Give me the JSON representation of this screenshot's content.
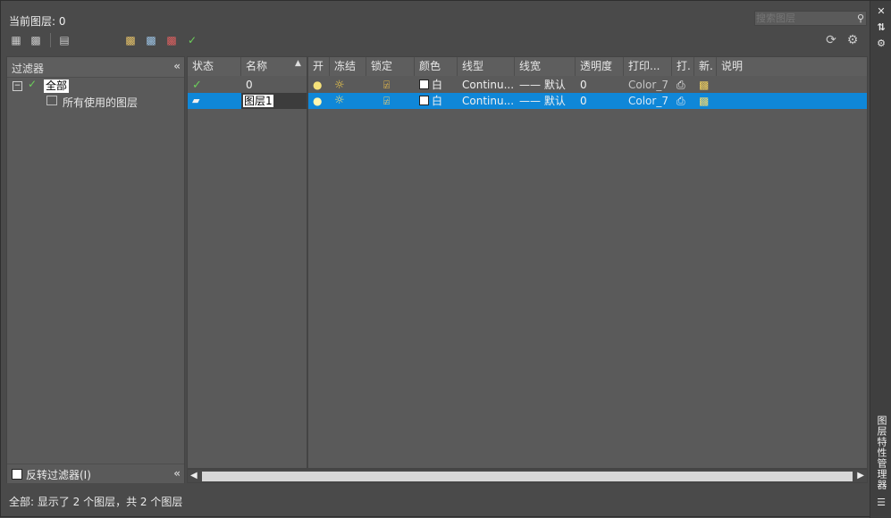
{
  "header": {
    "current_layer": "当前图层: 0",
    "search_placeholder": "搜索图层"
  },
  "toolbar": {
    "icons": [
      "new-property-filter-icon",
      "new-group-filter-icon",
      "layer-states-manager-icon",
      "new-layer-icon",
      "new-layer-vp-frozen-icon",
      "delete-layer-icon",
      "set-current-icon",
      "refresh-icon",
      "settings-icon"
    ]
  },
  "side_strip": {
    "title": "图层特性管理器"
  },
  "filter_panel": {
    "header": "过滤器",
    "tree": {
      "root": "全部",
      "child": "所有使用的图层"
    },
    "invert_filter": "反转过滤器(I)"
  },
  "table": {
    "columns": [
      "状态",
      "名称",
      "开",
      "冻结",
      "锁定",
      "颜色",
      "线型",
      "线宽",
      "透明度",
      "打印...",
      "打.",
      "新.",
      "说明"
    ],
    "rows": [
      {
        "status": "current",
        "name": "0",
        "on": "lightbulb-on",
        "freeze": "sun-thawed",
        "lock": "unlocked",
        "color_name": "白",
        "color_hex": "#ffffff",
        "linetype": "Continu...",
        "lineweight": "—— 默认",
        "transparency": "0",
        "plot_style": "Color_7",
        "selected": false
      },
      {
        "status": "in-use",
        "name": "图层1",
        "on": "lightbulb-on",
        "freeze": "sun-thawed",
        "lock": "unlocked",
        "color_name": "白",
        "color_hex": "#ffffff",
        "linetype": "Continu...",
        "lineweight": "—— 默认",
        "transparency": "0",
        "plot_style": "Color_7",
        "selected": true
      }
    ]
  },
  "status_bar": {
    "text": "全部: 显示了 2 个图层，共 2 个图层"
  },
  "colors": {
    "selection": "#0f87d8",
    "panel": "#5a5a5a",
    "window": "#4a4a4a"
  }
}
